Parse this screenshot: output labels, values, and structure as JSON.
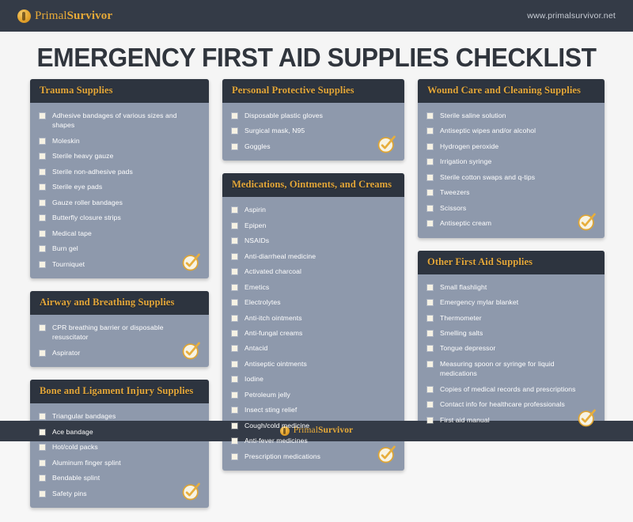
{
  "header": {
    "logo_primary": "Primal",
    "logo_secondary": "Survivor",
    "logo_icon": "survivor-circle-icon",
    "url": "www.primalsurvivor.net"
  },
  "title": "EMERGENCY FIRST AID SUPPLIES CHECKLIST",
  "colors": {
    "header_bar": "#343b47",
    "card_header": "#2d343f",
    "card_body": "#8e99ac",
    "accent_gold": "#e4a739",
    "checkbox": "#f6f2e4",
    "text": "#ffffff",
    "page_bg": "#f5f5f5",
    "title": "#30353d"
  },
  "columns": [
    {
      "cards": [
        {
          "title": "Trauma Supplies",
          "badge": "check-badge",
          "items": [
            "Adhesive bandages of various sizes and shapes",
            "Moleskin",
            "Sterile heavy gauze",
            "Sterile non-adhesive pads",
            "Sterile eye pads",
            "Gauze roller bandages",
            "Butterfly closure strips",
            "Medical tape",
            "Burn gel",
            "Tourniquet"
          ]
        },
        {
          "title": "Airway and Breathing Supplies",
          "badge": "check-badge",
          "items": [
            "CPR breathing barrier or disposable resuscitator",
            "Aspirator"
          ]
        },
        {
          "title": "Bone and Ligament Injury Supplies",
          "badge": "check-badge",
          "items": [
            "Triangular bandages",
            "Ace bandage",
            "Hot/cold packs",
            "Aluminum finger splint",
            "Bendable splint",
            "Safety pins"
          ]
        }
      ]
    },
    {
      "cards": [
        {
          "title": "Personal Protective Supplies",
          "badge": "check-badge",
          "items": [
            "Disposable plastic gloves",
            "Surgical mask, N95",
            "Goggles"
          ]
        },
        {
          "title": "Medications, Ointments, and Creams",
          "badge": "check-badge",
          "items": [
            "Aspirin",
            "Epipen",
            "NSAIDs",
            "Anti-diarrheal medicine",
            "Activated charcoal",
            "Emetics",
            "Electrolytes",
            "Anti-itch ointments",
            "Anti-fungal creams",
            "Antacid",
            "Antiseptic ointments",
            "Iodine",
            "Petroleum jelly",
            "Insect sting relief",
            "Cough/cold medicine",
            "Anti-fever medicines",
            "Prescription medications"
          ]
        }
      ]
    },
    {
      "cards": [
        {
          "title": "Wound Care and Cleaning Supplies",
          "badge": "check-badge",
          "items": [
            "Sterile saline solution",
            "Antiseptic wipes and/or alcohol",
            "Hydrogen peroxide",
            "Irrigation syringe",
            "Sterile cotton swaps and q-tips",
            "Tweezers",
            "Scissors",
            "Antiseptic cream"
          ]
        },
        {
          "title": "Other First Aid Supplies",
          "badge": "check-badge",
          "items": [
            "Small flashlight",
            "Emergency mylar blanket",
            "Thermometer",
            "Smelling salts",
            "Tongue depressor",
            "Measuring spoon or syringe for liquid medications",
            "Copies of medical records and prescriptions",
            "Contact info for healthcare professionals",
            "First aid manual"
          ]
        }
      ]
    }
  ],
  "footer": {
    "logo_primary": "Primal",
    "logo_secondary": "Survivor",
    "logo_icon": "survivor-circle-icon"
  }
}
